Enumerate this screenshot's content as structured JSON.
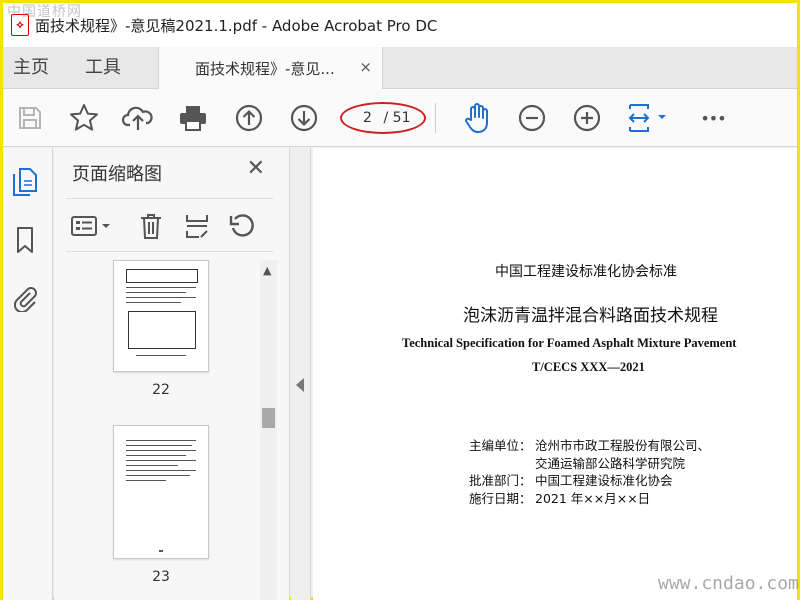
{
  "window": {
    "title": "面技术规程》-意见稿2021.1.pdf - Adobe Acrobat Pro DC"
  },
  "watermarks": {
    "top_left": "中国道桥网",
    "bottom_right": "www.cndao.com"
  },
  "tabs": {
    "home": "主页",
    "tools": "工具",
    "document": "面技术规程》-意见...",
    "close": "×"
  },
  "toolbar": {
    "icons": [
      "save-icon",
      "star-icon",
      "upload-cloud-icon",
      "print-icon",
      "page-up-icon",
      "page-down-icon",
      "hand-tool-icon",
      "zoom-out-icon",
      "zoom-in-icon",
      "fit-page-icon",
      "more-icon"
    ],
    "page_current": "2",
    "page_total": "/ 51",
    "more": "•••"
  },
  "thumbnail_panel": {
    "title": "页面缩略图",
    "close": "✕",
    "pages": [
      {
        "label": "22"
      },
      {
        "label": "23"
      }
    ]
  },
  "document": {
    "standard_org": "中国工程建设标准化协会标准",
    "title_cn": "泡沫沥青温拌混合料路面技术规程",
    "title_en": "Technical Specification for Foamed Asphalt Mixture Pavement",
    "code": "T/CECS XXX—2021",
    "meta": [
      {
        "label": "主编单位：",
        "value": "沧州市市政工程股份有限公司、"
      },
      {
        "label": "",
        "value": "交通运输部公路科学研究院"
      },
      {
        "label": "批准部门：",
        "value": "中国工程建设标准化协会"
      },
      {
        "label": "施行日期：",
        "value": "2021 年××月××日"
      }
    ]
  },
  "colors": {
    "accent_blue": "#1f6fd1",
    "highlight_red": "#cc2222",
    "border_yellow": "#f2e300"
  }
}
